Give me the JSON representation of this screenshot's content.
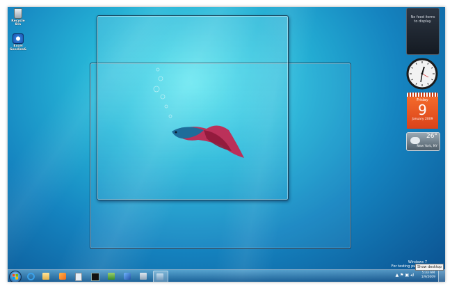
{
  "desktop": {
    "icons": [
      {
        "label": "Recycle Bin",
        "icon": "recycle-bin-icon"
      },
      {
        "label": "Excel Goodies&",
        "icon": "program-icon"
      }
    ]
  },
  "gadgets": {
    "feed": {
      "message": "No feed items to display."
    },
    "calendar": {
      "weekday": "Friday",
      "day": "9",
      "month_year": "January 2009"
    },
    "weather": {
      "temperature": "26°",
      "location": "New York, NY"
    }
  },
  "taskbar": {
    "programs": [
      {
        "name": "internet-explorer-icon"
      },
      {
        "name": "explorer-folder-icon"
      },
      {
        "name": "media-player-icon"
      },
      {
        "name": "document-icon"
      },
      {
        "name": "command-prompt-icon"
      },
      {
        "name": "network-icon"
      },
      {
        "name": "control-panel-icon"
      },
      {
        "name": "help-icon"
      },
      {
        "name": "window-switch-icon"
      }
    ],
    "clock_time": "5:33 AM",
    "clock_date": "1/9/2009",
    "tooltip": "Show desktop"
  },
  "watermark": {
    "line1": "Windows 7",
    "line2": "For testing purposes"
  }
}
